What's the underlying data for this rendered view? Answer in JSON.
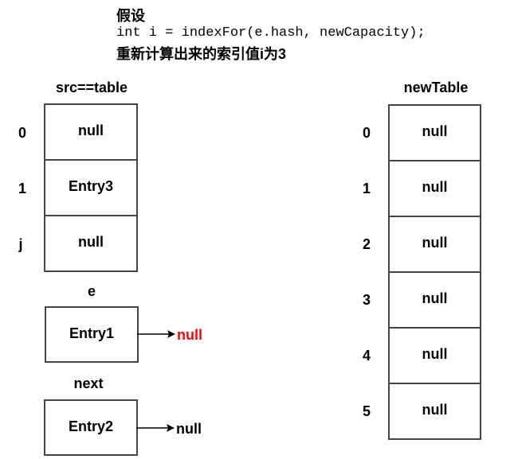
{
  "header": {
    "line1": "假设",
    "line2": "int i = indexFor(e.hash, newCapacity);",
    "line3": "重新计算出来的索引值i为3"
  },
  "src_table": {
    "title": "src==table",
    "rows": [
      {
        "index": "0",
        "value": "null"
      },
      {
        "index": "1",
        "value": "Entry3"
      },
      {
        "index": "j",
        "value": "null"
      }
    ]
  },
  "e_node": {
    "label": "e",
    "value": "Entry1",
    "next": "null",
    "next_color": "#ff0000"
  },
  "next_node": {
    "label": "next",
    "value": "Entry2",
    "next": "null"
  },
  "new_table": {
    "title": "newTable",
    "rows": [
      {
        "index": "0",
        "value": "null"
      },
      {
        "index": "1",
        "value": "null"
      },
      {
        "index": "2",
        "value": "null"
      },
      {
        "index": "3",
        "value": "null"
      },
      {
        "index": "4",
        "value": "null"
      },
      {
        "index": "5",
        "value": "null"
      }
    ]
  }
}
